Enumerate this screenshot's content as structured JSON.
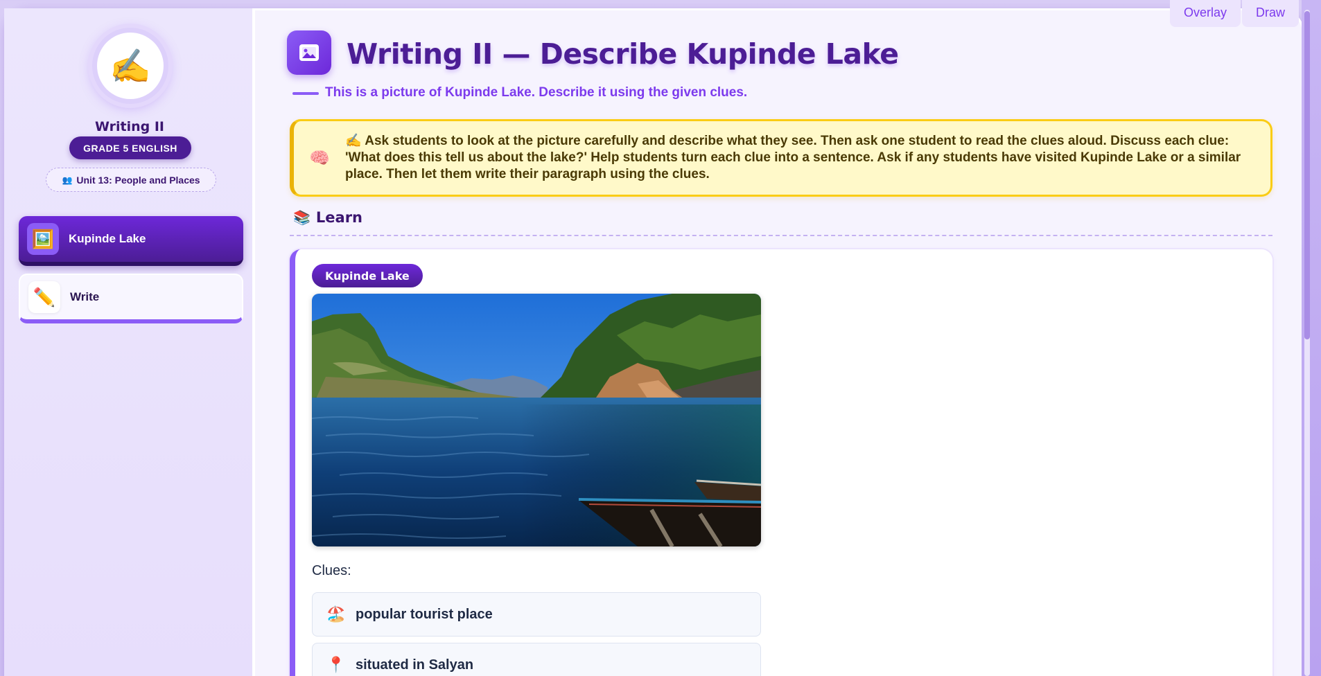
{
  "toolbar": {
    "overlay_label": "Overlay",
    "draw_label": "Draw"
  },
  "sidebar": {
    "avatar_icon": "✍️",
    "title": "Writing II",
    "grade_badge": "GRADE 5 ENGLISH",
    "unit_icon": "👥",
    "unit_label": "Unit 13: People and Places",
    "items": [
      {
        "icon": "🖼️",
        "label": "Kupinde Lake",
        "active": true
      },
      {
        "icon": "✏️",
        "label": "Write",
        "active": false
      }
    ]
  },
  "main": {
    "title": "Writing II — Describe Kupinde Lake",
    "subtitle": "This is a picture of Kupinde Lake. Describe it using the given clues.",
    "teacher_note_icon": "🧠",
    "teacher_note": "✍️ Ask students to look at the picture carefully and describe what they see. Then ask one student to read the clues aloud. Discuss each clue: 'What does this tell us about the lake?' Help students turn each clue into a sentence. Ask if any students have visited Kupinde Lake or a similar place. Then let them write their paragraph using the clues.",
    "section_icon": "📚",
    "section_title": "Learn",
    "card": {
      "pill": "Kupinde Lake",
      "clues_label": "Clues:",
      "clues": [
        {
          "icon": "🏖️",
          "text": "popular tourist place"
        },
        {
          "icon": "📍",
          "text": "situated in Salyan"
        }
      ]
    }
  },
  "colors": {
    "primary": "#4c1d95",
    "accent": "#8b5cf6",
    "note_bg": "#fff9c9",
    "note_border": "#facc15"
  }
}
